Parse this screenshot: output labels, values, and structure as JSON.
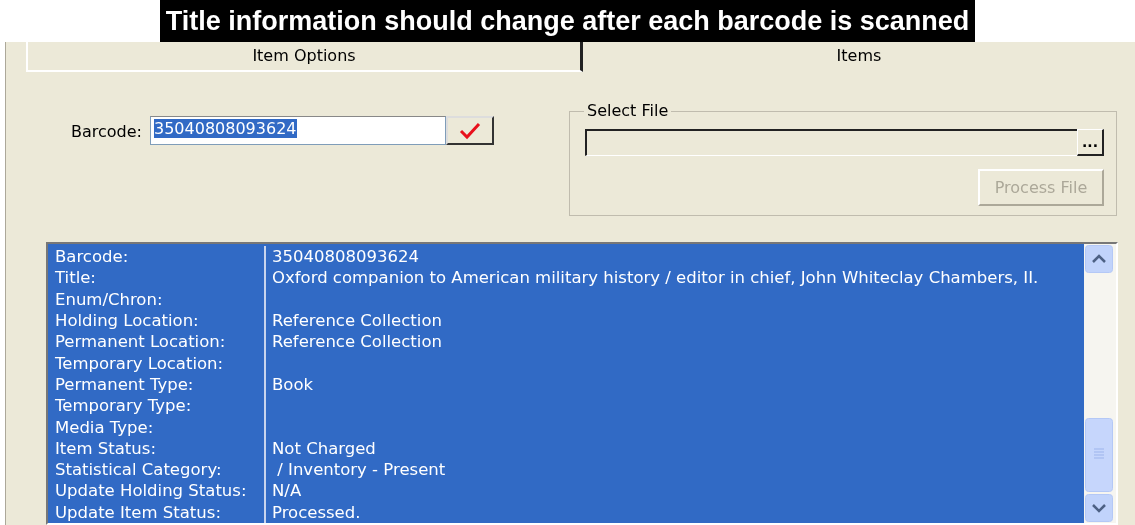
{
  "caption": "Title information should change after each barcode is scanned",
  "tabs": [
    {
      "label": "Item Options",
      "selected": true
    },
    {
      "label": "Items",
      "selected": false
    }
  ],
  "barcode": {
    "label": "Barcode:",
    "value": "35040808093624",
    "value_selected": true
  },
  "select_file": {
    "title": "Select File",
    "browse_button": "...",
    "process_button": {
      "label": "Process File",
      "disabled": true
    }
  },
  "details": [
    {
      "label": "Barcode:",
      "value": "35040808093624"
    },
    {
      "label": "Title:",
      "value": "Oxford companion to American military history / editor in chief, John Whiteclay Chambers, II."
    },
    {
      "label": "Enum/Chron:"
    },
    {
      "label": "Holding Location:",
      "value": "Reference Collection"
    },
    {
      "label": "Permanent Location:",
      "value": "Reference Collection"
    },
    {
      "label": "Temporary Location:"
    },
    {
      "label": "Permanent Type:",
      "value": "Book"
    },
    {
      "label": "Temporary Type:"
    },
    {
      "label": "Media Type:"
    },
    {
      "label": "Item Status:",
      "value": "Not Charged"
    },
    {
      "label": "Statistical Category:",
      "value": " / Inventory - Present"
    },
    {
      "label": "Update Holding Status:",
      "value": "N/A"
    },
    {
      "label": "Update Item Status:",
      "value": "Processed."
    }
  ]
}
